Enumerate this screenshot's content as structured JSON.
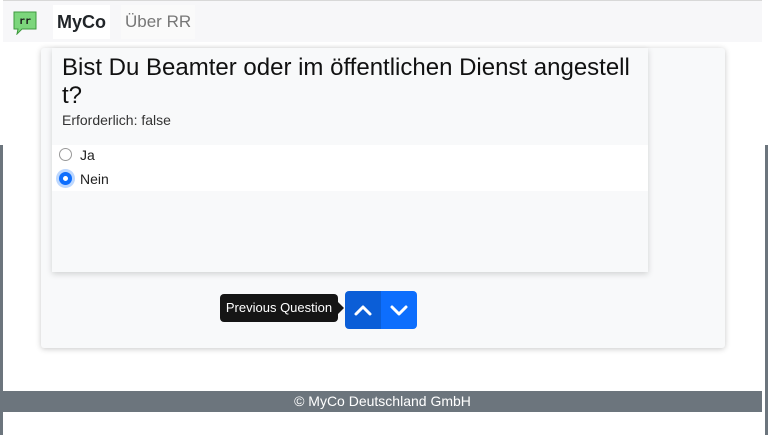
{
  "navbar": {
    "logo_text": "rr",
    "brand": "MyCo",
    "link_about": "Über RR"
  },
  "question": {
    "title": "Bist Du Beamter oder im öffentlichen Dienst angestellt?",
    "required": "Erforderlich: false",
    "choices": [
      {
        "label": "Ja",
        "checked": false
      },
      {
        "label": "Nein",
        "checked": true
      }
    ]
  },
  "navigation": {
    "tooltip": "Previous Question",
    "prev_icon": "chevron-up-icon",
    "next_icon": "chevron-down-icon"
  },
  "footer": {
    "text": "© MyCo Deutschland GmbH"
  },
  "colors": {
    "primary": "#0d6efd",
    "footer_bg": "#6c757d",
    "logo_green": "#7cd67c"
  }
}
